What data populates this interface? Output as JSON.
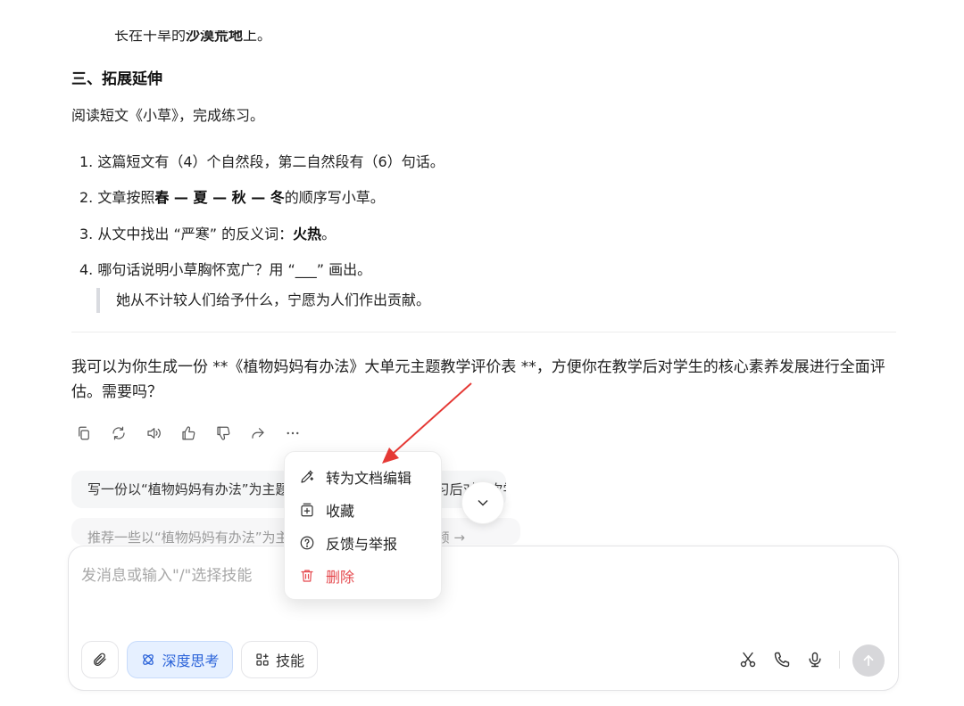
{
  "doc": {
    "cut_text_prefix": "长在干旱的",
    "cut_text_bold": "沙漠荒地",
    "cut_text_suffix": "上。",
    "section_heading": "三、拓展延伸",
    "intro": "阅读短文《小草》，完成练习。",
    "q1": "1. 这篇短文有（4）个自然段，第二自然段有（6）句话。",
    "q2_prefix": "2. 文章按照",
    "q2_bold": "春 — 夏 — 秋 — 冬",
    "q2_suffix": "的顺序写小草。",
    "q3_prefix": "3. 从文中找出 “严寒” 的反义词：",
    "q3_bold": "火热",
    "q3_suffix": "。",
    "q4": "4. 哪句话说明小草胸怀宽广？用 “___” 画出。",
    "quote": "她从不计较人们给予什么，宁愿为人们作出贡献。"
  },
  "answer": {
    "text": "我可以为你生成一份 **《植物妈妈有办法》大单元主题教学评价表 **，方便你在教学后对学生的核心素养发展进行全面评估。需要吗？"
  },
  "actions": [
    {
      "name": "copy-icon"
    },
    {
      "name": "regenerate-icon"
    },
    {
      "name": "speaker-icon"
    },
    {
      "name": "thumbs-up-icon"
    },
    {
      "name": "thumbs-down-icon"
    },
    {
      "name": "share-icon"
    },
    {
      "name": "more-icon"
    }
  ],
  "suggestions": [
    "写一份以“植物妈妈有办法”为主题的教学反思，让学生在学习后对本次学习进行评价与反思",
    "推荐一些以“植物妈妈有办法”为主题的与科学相关的教学视频 →"
  ],
  "menu": {
    "items": [
      {
        "label": "转为文档编辑",
        "icon": "edit-doc-icon"
      },
      {
        "label": "收藏",
        "icon": "bookmark-add-icon"
      },
      {
        "label": "反馈与举报",
        "icon": "help-circle-icon"
      },
      {
        "label": "删除",
        "icon": "trash-icon",
        "color": "#e5484d"
      }
    ]
  },
  "composer": {
    "placeholder": "发消息或输入\"/\"选择技能",
    "deep_think_label": "深度思考",
    "skills_label": "技能",
    "icons": [
      "paperclip-icon",
      "scissors-icon",
      "phone-icon",
      "microphone-icon",
      "send-icon"
    ]
  },
  "colors": {
    "accent": "#2b63d9",
    "accent_bg": "#e6f0ff",
    "danger": "#e5484d",
    "annotation_arrow": "#e53935"
  }
}
